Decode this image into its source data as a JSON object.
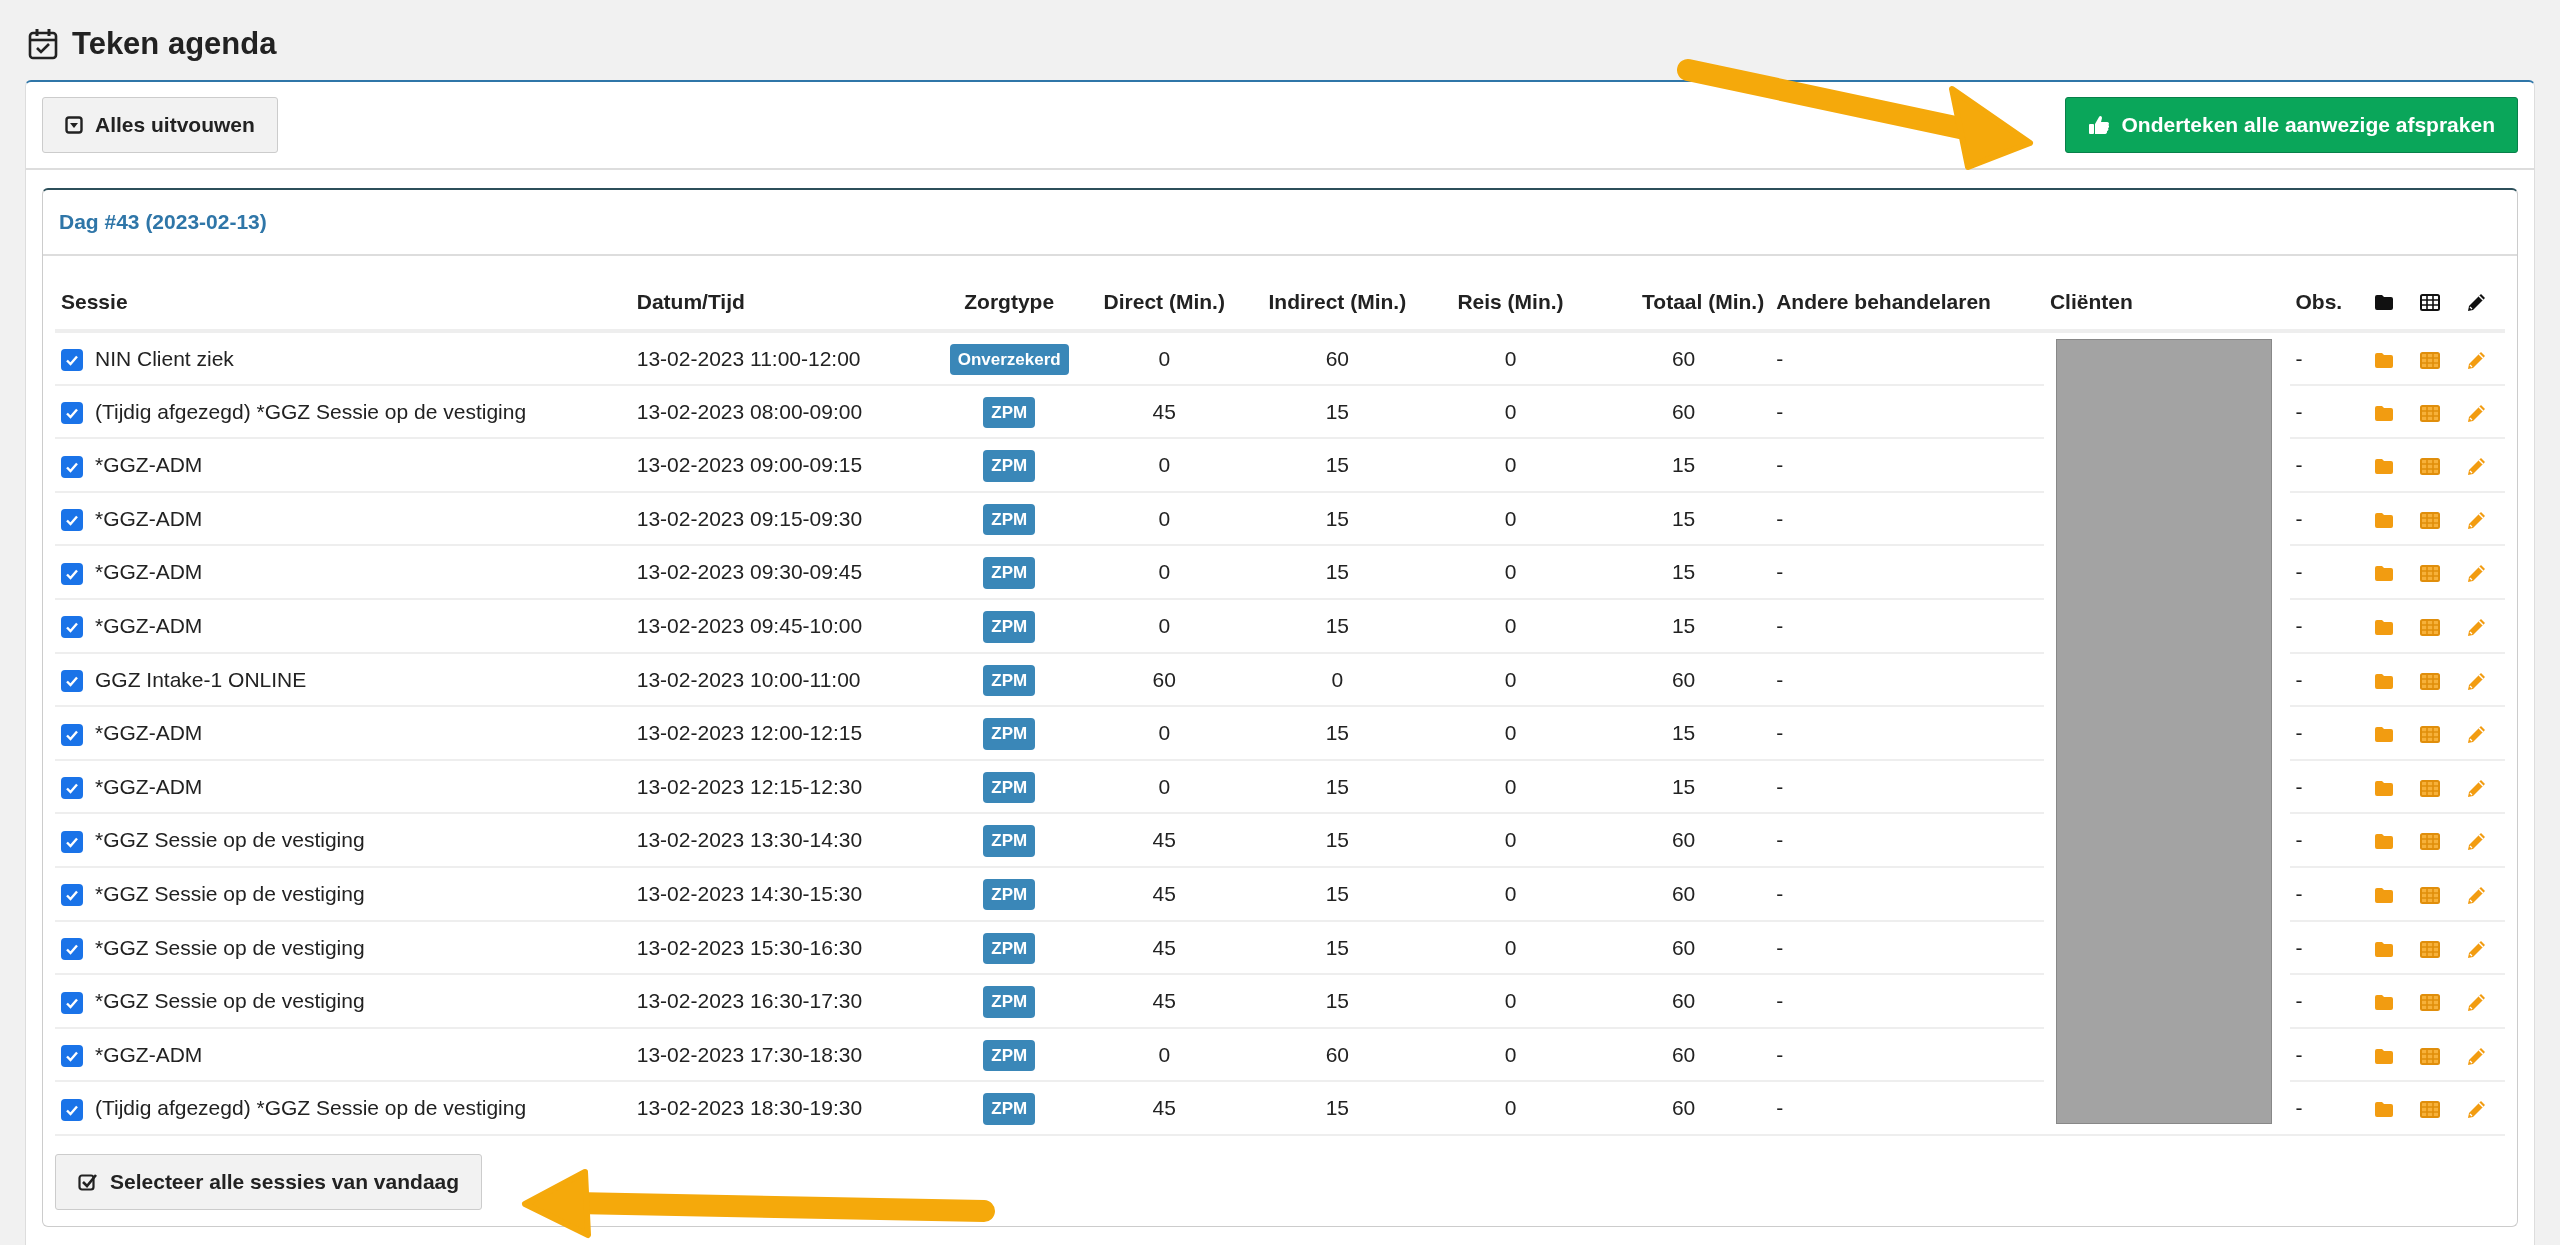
{
  "page_title": "Teken agenda",
  "toolbar": {
    "expand_button": "Alles uitvouwen",
    "sign_button": "Onderteken alle aanwezige afspraken"
  },
  "day_card": {
    "title": "Dag #43 (2023-02-13)",
    "columns": [
      "Sessie",
      "Datum/Tijd",
      "Zorgtype",
      "Direct (Min.)",
      "Indirect (Min.)",
      "Reis (Min.)",
      "Totaal (Min.)",
      "Andere behandelaren",
      "Cliënten",
      "Obs."
    ],
    "rows": [
      {
        "checked": true,
        "session": "NIN Client ziek",
        "datetime": "13-02-2023 11:00-12:00",
        "care_type": "Onverzekerd",
        "direct": "0",
        "indirect": "60",
        "travel": "0",
        "total": "60",
        "other": "-",
        "obs": "-"
      },
      {
        "checked": true,
        "session": "(Tijdig afgezegd) *GGZ Sessie op de vestiging",
        "datetime": "13-02-2023 08:00-09:00",
        "care_type": "ZPM",
        "direct": "45",
        "indirect": "15",
        "travel": "0",
        "total": "60",
        "other": "-",
        "obs": "-"
      },
      {
        "checked": true,
        "session": "*GGZ-ADM",
        "datetime": "13-02-2023 09:00-09:15",
        "care_type": "ZPM",
        "direct": "0",
        "indirect": "15",
        "travel": "0",
        "total": "15",
        "other": "-",
        "obs": "-"
      },
      {
        "checked": true,
        "session": "*GGZ-ADM",
        "datetime": "13-02-2023 09:15-09:30",
        "care_type": "ZPM",
        "direct": "0",
        "indirect": "15",
        "travel": "0",
        "total": "15",
        "other": "-",
        "obs": "-"
      },
      {
        "checked": true,
        "session": "*GGZ-ADM",
        "datetime": "13-02-2023 09:30-09:45",
        "care_type": "ZPM",
        "direct": "0",
        "indirect": "15",
        "travel": "0",
        "total": "15",
        "other": "-",
        "obs": "-"
      },
      {
        "checked": true,
        "session": "*GGZ-ADM",
        "datetime": "13-02-2023 09:45-10:00",
        "care_type": "ZPM",
        "direct": "0",
        "indirect": "15",
        "travel": "0",
        "total": "15",
        "other": "-",
        "obs": "-"
      },
      {
        "checked": true,
        "session": "GGZ Intake-1 ONLINE",
        "datetime": "13-02-2023 10:00-11:00",
        "care_type": "ZPM",
        "direct": "60",
        "indirect": "0",
        "travel": "0",
        "total": "60",
        "other": "-",
        "obs": "-"
      },
      {
        "checked": true,
        "session": "*GGZ-ADM",
        "datetime": "13-02-2023 12:00-12:15",
        "care_type": "ZPM",
        "direct": "0",
        "indirect": "15",
        "travel": "0",
        "total": "15",
        "other": "-",
        "obs": "-"
      },
      {
        "checked": true,
        "session": "*GGZ-ADM",
        "datetime": "13-02-2023 12:15-12:30",
        "care_type": "ZPM",
        "direct": "0",
        "indirect": "15",
        "travel": "0",
        "total": "15",
        "other": "-",
        "obs": "-"
      },
      {
        "checked": true,
        "session": "*GGZ Sessie op de vestiging",
        "datetime": "13-02-2023 13:30-14:30",
        "care_type": "ZPM",
        "direct": "45",
        "indirect": "15",
        "travel": "0",
        "total": "60",
        "other": "-",
        "obs": "-"
      },
      {
        "checked": true,
        "session": "*GGZ Sessie op de vestiging",
        "datetime": "13-02-2023 14:30-15:30",
        "care_type": "ZPM",
        "direct": "45",
        "indirect": "15",
        "travel": "0",
        "total": "60",
        "other": "-",
        "obs": "-"
      },
      {
        "checked": true,
        "session": "*GGZ Sessie op de vestiging",
        "datetime": "13-02-2023 15:30-16:30",
        "care_type": "ZPM",
        "direct": "45",
        "indirect": "15",
        "travel": "0",
        "total": "60",
        "other": "-",
        "obs": "-"
      },
      {
        "checked": true,
        "session": "*GGZ Sessie op de vestiging",
        "datetime": "13-02-2023 16:30-17:30",
        "care_type": "ZPM",
        "direct": "45",
        "indirect": "15",
        "travel": "0",
        "total": "60",
        "other": "-",
        "obs": "-"
      },
      {
        "checked": true,
        "session": "*GGZ-ADM",
        "datetime": "13-02-2023 17:30-18:30",
        "care_type": "ZPM",
        "direct": "0",
        "indirect": "60",
        "travel": "0",
        "total": "60",
        "other": "-",
        "obs": "-"
      },
      {
        "checked": true,
        "session": "(Tijdig afgezegd) *GGZ Sessie op de vestiging",
        "datetime": "13-02-2023 18:30-19:30",
        "care_type": "ZPM",
        "direct": "45",
        "indirect": "15",
        "travel": "0",
        "total": "60",
        "other": "-",
        "obs": "-"
      }
    ],
    "select_all_button": "Selecteer alle sessies van vandaag"
  }
}
